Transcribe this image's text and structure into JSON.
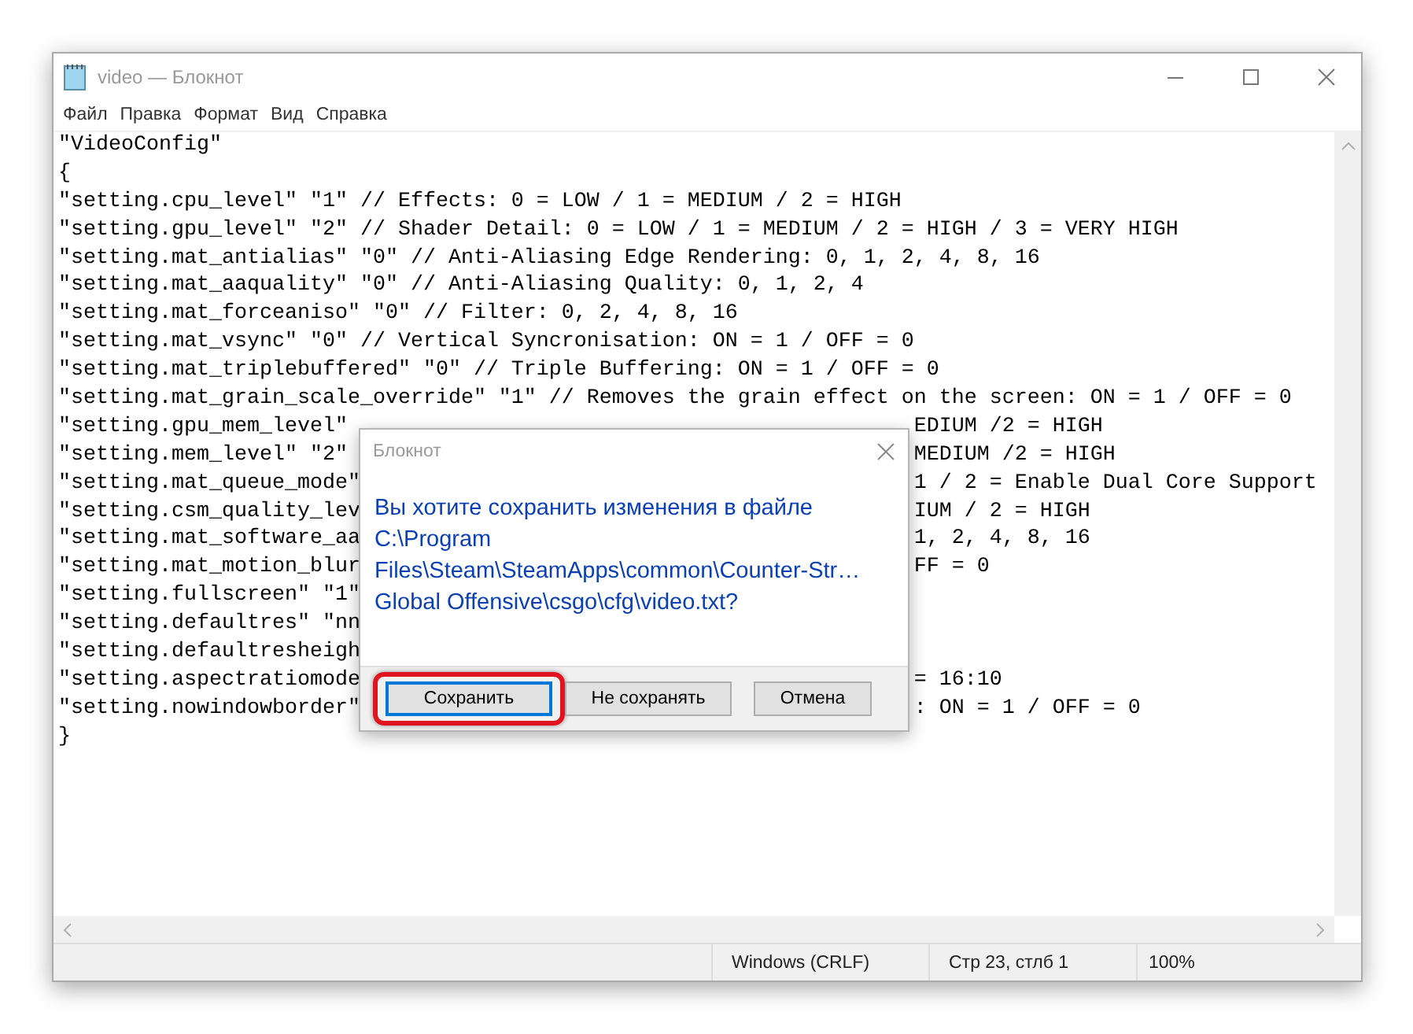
{
  "window": {
    "title": "video — Блокнот"
  },
  "menu": [
    "Файл",
    "Правка",
    "Формат",
    "Вид",
    "Справка"
  ],
  "editor": {
    "lines": [
      {
        "text": "\"VideoConfig\""
      },
      {
        "text": "{"
      },
      {
        "text": "\"setting.cpu_level\" \"1\" // Effects: 0 = LOW / 1 = MEDIUM / 2 = HIGH"
      },
      {
        "text": "\"setting.gpu_level\" \"2\" // Shader Detail: 0 = LOW / 1 = MEDIUM / 2 = HIGH / 3 = VERY HIGH"
      },
      {
        "text": "\"setting.mat_antialias\" \"0\" // Anti-Aliasing Edge Rendering: 0, 1, 2, 4, 8, 16"
      },
      {
        "text": "\"setting.mat_aaquality\" \"0\" // Anti-Aliasing Quality: 0, 1, 2, 4"
      },
      {
        "text": "\"setting.mat_forceaniso\" \"0\" // Filter: 0, 2, 4, 8, 16"
      },
      {
        "text": "\"setting.mat_vsync\" \"0\" // Vertical Syncronisation: ON = 1 / OFF = 0"
      },
      {
        "text": "\"setting.mat_triplebuffered\" \"0\" // Triple Buffering: ON = 1 / OFF = 0"
      },
      {
        "text": "\"setting.mat_grain_scale_override\" \"1\" // Removes the grain effect on the screen: ON = 1 / OFF = 0"
      },
      {
        "left": "\"setting.gpu_mem_level\"",
        "right": "EDIUM /2 = HIGH"
      },
      {
        "left": "\"setting.mem_level\" \"2\"",
        "right": "MEDIUM /2 = HIGH"
      },
      {
        "left": "\"setting.mat_queue_mode\"",
        "right": "1 / 2 = Enable Dual Core Support"
      },
      {
        "left": "\"setting.csm_quality_lev",
        "right": "IUM / 2 = HIGH"
      },
      {
        "left": "\"setting.mat_software_aa",
        "right": "1, 2, 4, 8, 16"
      },
      {
        "left": "\"setting.mat_motion_blur",
        "right": "FF = 0"
      },
      {
        "left": "\"setting.fullscreen\" \"1\""
      },
      {
        "left": "\"setting.defaultres\" \"nn"
      },
      {
        "left": "\"setting.defaultresheigh"
      },
      {
        "left": "\"setting.aspectratiomode",
        "right": "= 16:10"
      },
      {
        "left": "\"setting.nowindowborder\"",
        "right": ": ON = 1 / OFF = 0"
      },
      {
        "text": "}"
      }
    ]
  },
  "dialog": {
    "title": "Блокнот",
    "message": [
      "Вы хотите сохранить изменения в файле",
      "C:\\Program",
      "Files\\Steam\\SteamApps\\common\\Counter-Str…",
      "Global Offensive\\csgo\\cfg\\video.txt?"
    ],
    "buttons": [
      {
        "label": "Сохранить",
        "focused": true,
        "highlighted": true
      },
      {
        "label": "Не сохранять",
        "focused": false,
        "highlighted": false
      },
      {
        "label": "Отмена",
        "focused": false,
        "highlighted": false
      }
    ]
  },
  "status_bar": [
    "Windows (CRLF)",
    "Стр 23, стлб 1",
    "100%"
  ]
}
